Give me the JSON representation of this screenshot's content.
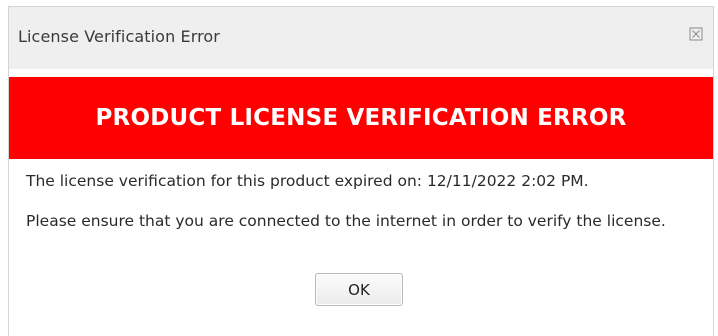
{
  "dialog": {
    "title": "License Verification Error",
    "close_icon": "close-icon",
    "banner_text": "PRODUCT LICENSE VERIFICATION ERROR",
    "message_expired": "The license verification for this product expired on: 12/11/2022 2:02 PM.",
    "message_connect": "Please ensure that you are connected to the internet in order to verify the license.",
    "ok_label": "OK"
  },
  "colors": {
    "banner": "#ff0000",
    "banner_text": "#ffffff",
    "titlebar": "#efefef"
  }
}
